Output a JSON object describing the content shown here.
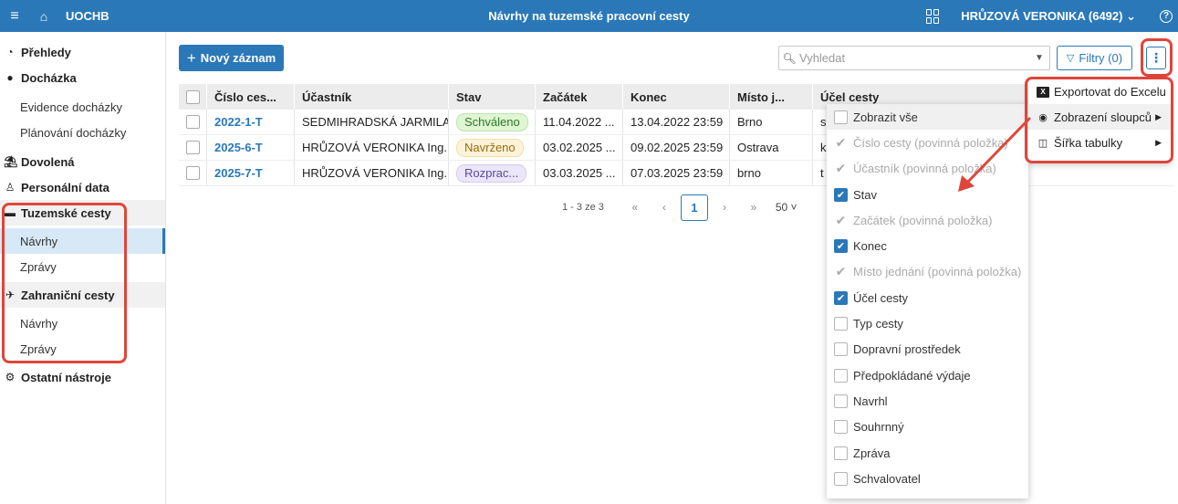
{
  "topbar": {
    "brand": "UOCHB",
    "title": "Návrhy na tuzemské pracovní cesty",
    "user": "HRŮZOVÁ VERONIKA (6492)",
    "user_chevron": "⌄",
    "help_icon": "?",
    "menu_icon": "≡",
    "home_icon": "⌂"
  },
  "sidebar": {
    "prehledy": "Přehledy",
    "dochazka": "Docházka",
    "dochazka_items": [
      "Evidence docházky",
      "Plánování docházky"
    ],
    "dovolena": "Dovolená",
    "personalni": "Personální data",
    "tuzemske": "Tuzemské cesty",
    "tuzemske_items": [
      "Návrhy",
      "Zprávy"
    ],
    "zahranicni": "Zahraniční cesty",
    "zahranicni_items": [
      "Návrhy",
      "Zprávy"
    ],
    "ostatni": "Ostatní nástroje"
  },
  "toolbar": {
    "new_label": "Nový záznam",
    "search_placeholder": "Vyhledat",
    "filter_label": "Filtry (0)",
    "more_icon": "⋮"
  },
  "table": {
    "headers": [
      "Číslo ces...",
      "Účastník",
      "Stav",
      "Začátek",
      "Konec",
      "Místo j...",
      "Účel cesty"
    ],
    "rows": [
      {
        "cislo": "2022-1-T",
        "ucastnik": "SEDMIHRADSKÁ JARMILA...",
        "stav": "Schváleno",
        "zacatek": "11.04.2022 ...",
        "konec": "13.04.2022 23:59",
        "misto": "Brno",
        "ucel": "s"
      },
      {
        "cislo": "2025-6-T",
        "ucastnik": "HRŮZOVÁ VERONIKA Ing...",
        "stav": "Navrženo",
        "zacatek": "03.02.2025 ...",
        "konec": "09.02.2025 23:59",
        "misto": "Ostrava",
        "ucel": "k"
      },
      {
        "cislo": "2025-7-T",
        "ucastnik": "HRŮZOVÁ VERONIKA Ing...",
        "stav": "Rozprac...",
        "zacatek": "03.03.2025 ...",
        "konec": "07.03.2025 23:59",
        "misto": "brno",
        "ucel": "t"
      }
    ],
    "status_colors": {
      "Schváleno": "#2d7a1f",
      "Navrženo": "#9a6a12",
      "Rozprac...": "#5b4aa0"
    }
  },
  "pager": {
    "info": "1 - 3 ze 3",
    "first": "«",
    "prev": "‹",
    "current": "1",
    "next": "›",
    "last": "»",
    "page_size": "50"
  },
  "columns_menu": {
    "options": [
      {
        "label": "Zobrazit vše",
        "state": "off"
      },
      {
        "label": "Číslo cesty (povinná položka)",
        "state": "disabled"
      },
      {
        "label": "Účastník (povinná položka)",
        "state": "disabled"
      },
      {
        "label": "Stav",
        "state": "on"
      },
      {
        "label": "Začátek (povinná položka)",
        "state": "disabled"
      },
      {
        "label": "Konec",
        "state": "on"
      },
      {
        "label": "Místo jednání (povinná položka)",
        "state": "disabled"
      },
      {
        "label": "Účel cesty",
        "state": "on"
      },
      {
        "label": "Typ cesty",
        "state": "off"
      },
      {
        "label": "Dopravní prostředek",
        "state": "off"
      },
      {
        "label": "Předpokládané výdaje",
        "state": "off"
      },
      {
        "label": "Navrhl",
        "state": "off"
      },
      {
        "label": "Souhrnný",
        "state": "off"
      },
      {
        "label": "Zpráva",
        "state": "off"
      },
      {
        "label": "Schvalovatel",
        "state": "off"
      }
    ]
  },
  "more_menu": {
    "export": "Exportovat do Excelu",
    "columns": "Zobrazení sloupců",
    "width": "Šířka tabulky"
  },
  "colors": {
    "primary": "#2b78b8",
    "highlight": "#e0453a"
  }
}
